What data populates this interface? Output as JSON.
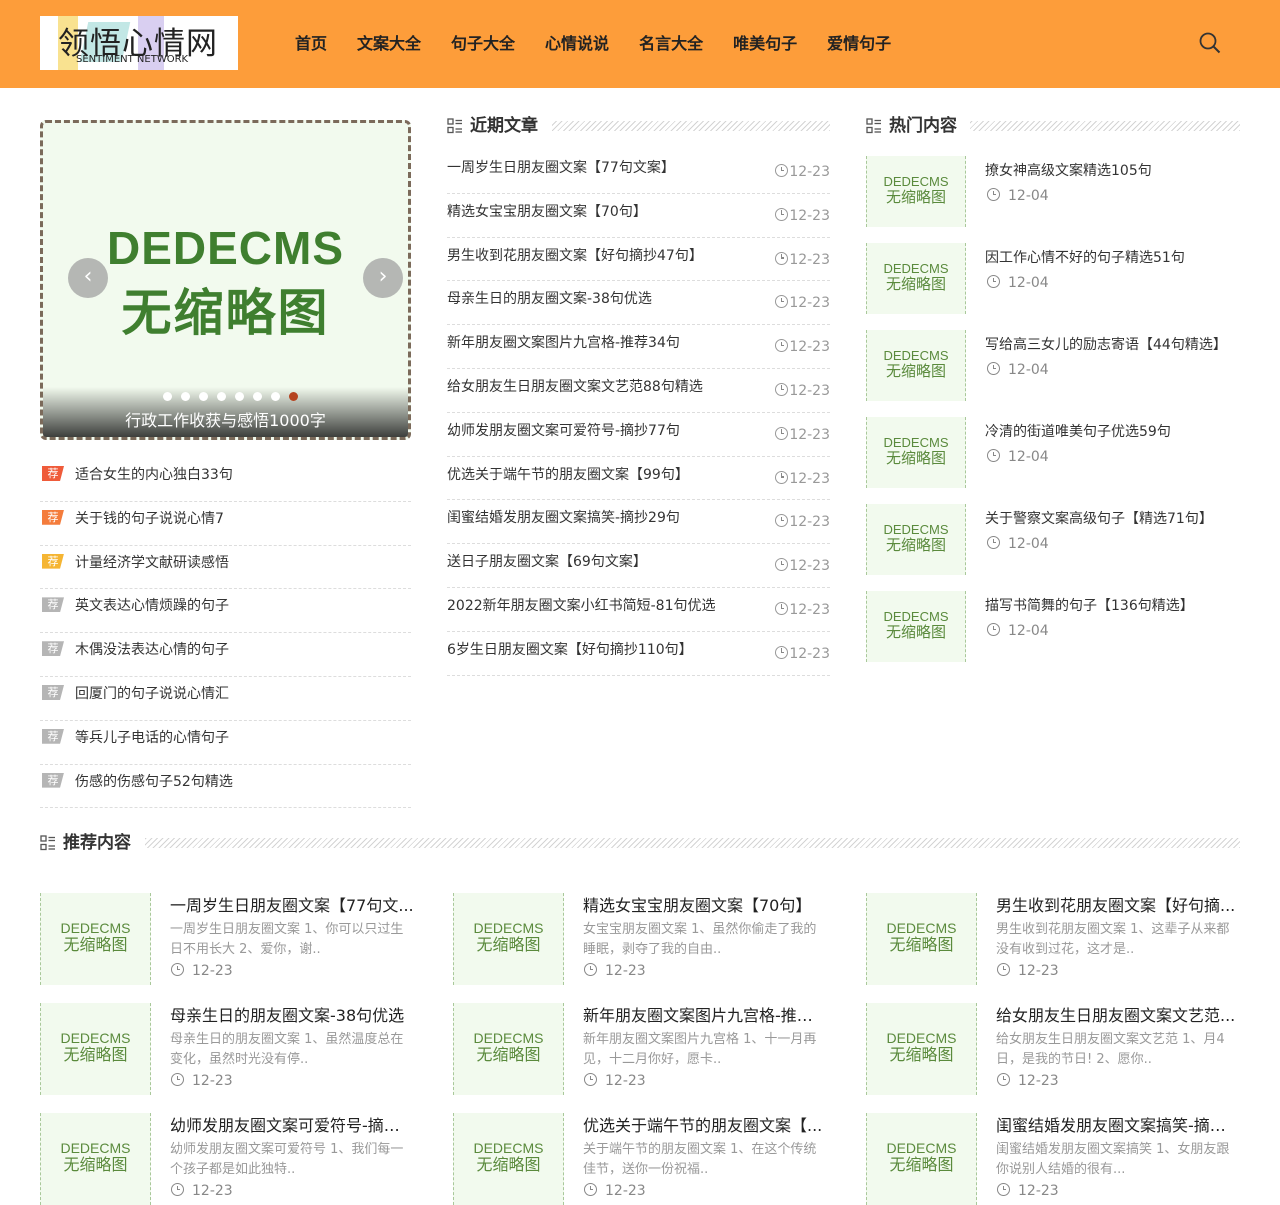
{
  "logo": {
    "cn": "领悟心情网",
    "en": "SENTIMENT NETWORK"
  },
  "nav": [
    "首页",
    "文案大全",
    "句子大全",
    "心情说说",
    "名言大全",
    "唯美句子",
    "爱情句子"
  ],
  "slider": {
    "thumb_line1": "DEDECMS",
    "thumb_line2": "无缩略图",
    "caption": "行政工作收获与感悟1000字",
    "dots": 8,
    "active_dot": 8,
    "prev": "‹",
    "next": "›"
  },
  "tag_label": "荐",
  "colors": {
    "accent": "#fd9d3a",
    "tag_red": "#ef5b3a",
    "tag_orange": "#f47c3c",
    "tag_yellow": "#f5b533",
    "tag_gray": "#b5b5b5"
  },
  "left_list": [
    {
      "text": "适合女生的内心独白33句",
      "tag_color": "#ef5b3a"
    },
    {
      "text": "关于钱的句子说说心情7",
      "tag_color": "#f47c3c"
    },
    {
      "text": "计量经济学文献研读感悟",
      "tag_color": "#f5b533"
    },
    {
      "text": "英文表达心情烦躁的句子",
      "tag_color": "#b5b5b5"
    },
    {
      "text": "木偶没法表达心情的句子",
      "tag_color": "#b5b5b5"
    },
    {
      "text": "回厦门的句子说说心情汇",
      "tag_color": "#b5b5b5"
    },
    {
      "text": "等兵儿子电话的心情句子",
      "tag_color": "#b5b5b5"
    },
    {
      "text": "伤感的伤感句子52句精选",
      "tag_color": "#b5b5b5"
    }
  ],
  "recent": {
    "title": "近期文章",
    "items": [
      {
        "text": "一周岁生日朋友圈文案【77句文案】",
        "date": "12-23"
      },
      {
        "text": "精选女宝宝朋友圈文案【70句】",
        "date": "12-23"
      },
      {
        "text": "男生收到花朋友圈文案【好句摘抄47句】",
        "date": "12-23"
      },
      {
        "text": "母亲生日的朋友圈文案-38句优选",
        "date": "12-23"
      },
      {
        "text": "新年朋友圈文案图片九宫格-推荐34句",
        "date": "12-23"
      },
      {
        "text": "给女朋友生日朋友圈文案文艺范88句精选",
        "date": "12-23"
      },
      {
        "text": "幼师发朋友圈文案可爱符号-摘抄77句",
        "date": "12-23"
      },
      {
        "text": "优选关于端午节的朋友圈文案【99句】",
        "date": "12-23"
      },
      {
        "text": "闺蜜结婚发朋友圈文案搞笑-摘抄29句",
        "date": "12-23"
      },
      {
        "text": "送日子朋友圈文案【69句文案】",
        "date": "12-23"
      },
      {
        "text": "2022新年朋友圈文案小红书简短-81句优选",
        "date": "12-23"
      },
      {
        "text": "6岁生日朋友圈文案【好句摘抄110句】",
        "date": "12-23"
      }
    ]
  },
  "hot": {
    "title": "热门内容",
    "items": [
      {
        "text": "撩女神高级文案精选105句",
        "date": "12-04"
      },
      {
        "text": "因工作心情不好的句子精选51句",
        "date": "12-04"
      },
      {
        "text": "写给高三女儿的励志寄语【44句精选】",
        "date": "12-04"
      },
      {
        "text": "冷清的街道唯美句子优选59句",
        "date": "12-04"
      },
      {
        "text": "关于警察文案高级句子【精选71句】",
        "date": "12-04"
      },
      {
        "text": "描写书简舞的句子【136句精选】",
        "date": "12-04"
      }
    ]
  },
  "recommended": {
    "title": "推荐内容",
    "items": [
      {
        "title": "一周岁生日朋友圈文案【77句文...",
        "desc": "一周岁生日朋友圈文案 1、你可以只过生日不用长大 2、爱你，谢..",
        "date": "12-23"
      },
      {
        "title": "精选女宝宝朋友圈文案【70句】",
        "desc": "女宝宝朋友圈文案 1、虽然你偷走了我的睡眠，剥夺了我的自由..",
        "date": "12-23"
      },
      {
        "title": "男生收到花朋友圈文案【好句摘...",
        "desc": "男生收到花朋友圈文案 1、这辈子从来都没有收到过花，这才是..",
        "date": "12-23"
      },
      {
        "title": "母亲生日的朋友圈文案-38句优选",
        "desc": "母亲生日的朋友圈文案 1、虽然温度总在变化，虽然时光没有停..",
        "date": "12-23"
      },
      {
        "title": "新年朋友圈文案图片九宫格-推荐...",
        "desc": "新年朋友圈文案图片九宫格 1、十一月再见，十二月你好，愿卡..",
        "date": "12-23"
      },
      {
        "title": "给女朋友生日朋友圈文案文艺范...",
        "desc": "给女朋友生日朋友圈文案文艺范 1、月4日，是我的节日! 2、愿你..",
        "date": "12-23"
      },
      {
        "title": "幼师发朋友圈文案可爱符号-摘抄...",
        "desc": "幼师发朋友圈文案可爱符号 1、我们每一个孩子都是如此独特..",
        "date": "12-23"
      },
      {
        "title": "优选关于端午节的朋友圈文案【...",
        "desc": "关于端午节的朋友圈文案 1、在这个传统佳节，送你一份祝福..",
        "date": "12-23"
      },
      {
        "title": "闺蜜结婚发朋友圈文案搞笑-摘抄...",
        "desc": "闺蜜结婚发朋友圈文案搞笑 1、女朋友跟你说别人结婚的很有... ",
        "date": "12-23"
      }
    ]
  }
}
